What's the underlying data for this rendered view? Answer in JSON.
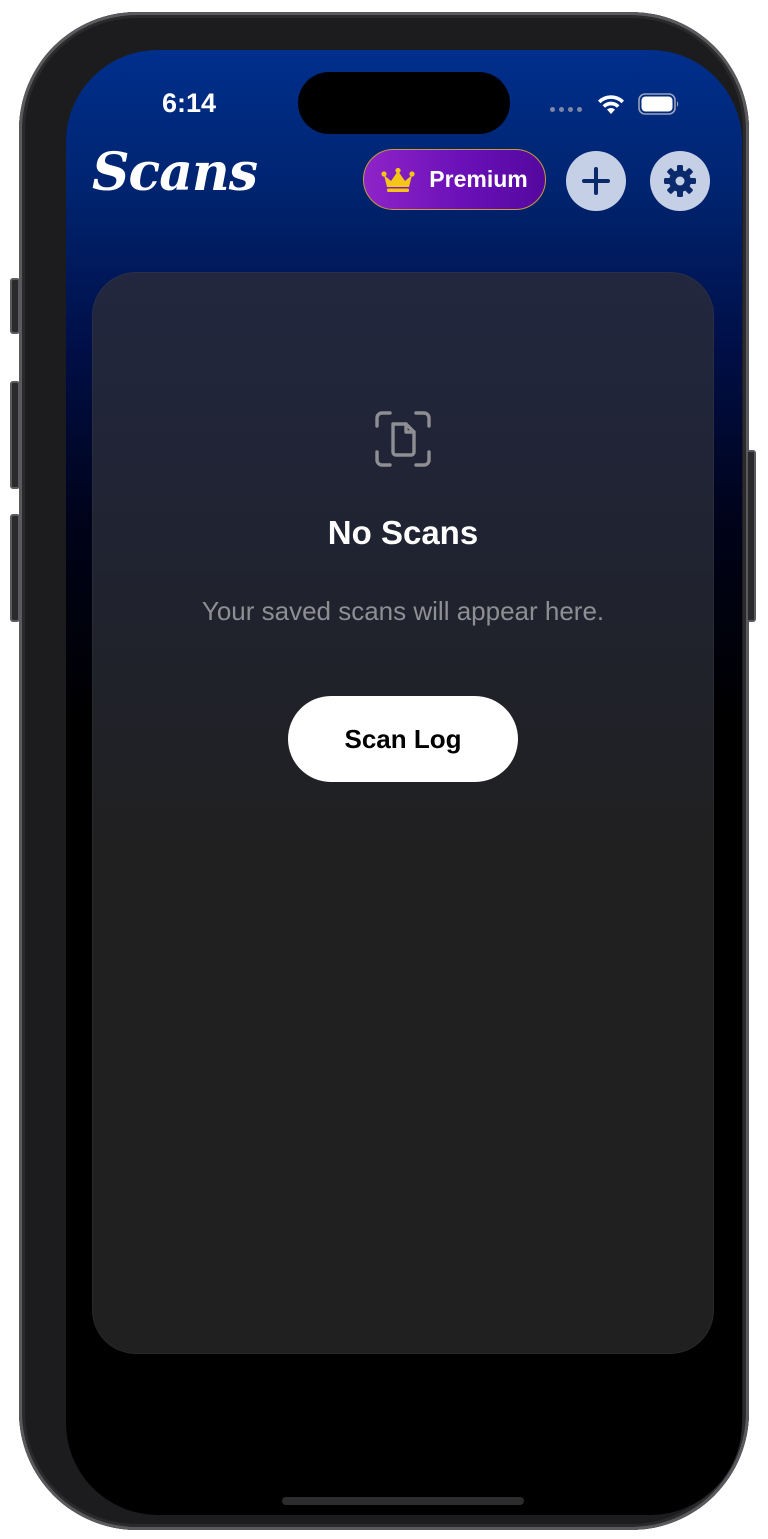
{
  "status_bar": {
    "time": "6:14",
    "wifi_icon": "wifi-icon",
    "battery_icon": "battery-icon",
    "signal_icon": "cellular-signal-icon"
  },
  "header": {
    "title": "Scans",
    "premium_label": "Premium",
    "premium_icon": "crown-icon",
    "add_icon": "plus-icon",
    "settings_icon": "gear-icon"
  },
  "empty_state": {
    "icon": "document-scan-icon",
    "title": "No Scans",
    "subtitle": "Your saved scans will appear here.",
    "button_label": "Scan Log"
  },
  "colors": {
    "header_gradient_top": "#002f8c",
    "premium_gradient_start": "#8e24c8",
    "premium_gradient_end": "#54089e",
    "premium_border": "#c89a3a",
    "crown": "#f5c518",
    "circle_button_bg": "#c5cfe6",
    "circle_button_icon": "#0b2a6b",
    "card_bg": "#202020"
  }
}
